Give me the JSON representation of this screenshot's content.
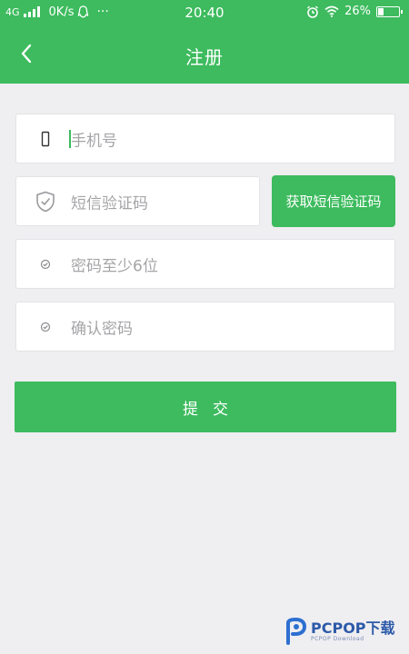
{
  "status_bar": {
    "network": "4G",
    "speed": "0K/s",
    "more": "···",
    "time": "20:40",
    "battery": "26%",
    "battery_level": 0.26
  },
  "nav": {
    "title": "注册"
  },
  "form": {
    "phone_placeholder": "手机号",
    "sms_code_placeholder": "短信验证码",
    "get_sms_label": "获取短信验证码",
    "password_placeholder": "密码至少6位",
    "confirm_placeholder": "确认密码",
    "submit_label": "提交"
  },
  "watermark": {
    "name": "PCPOP下载",
    "sub": "PCPOP Download"
  },
  "colors": {
    "accent": "#3dbb5e",
    "background": "#efeef1",
    "placeholder": "#a5a5a8"
  },
  "icons": {
    "back": "chevron-left-icon",
    "phone": "phone-icon",
    "shield": "shield-check-icon",
    "lock": "lock-check-icon"
  }
}
